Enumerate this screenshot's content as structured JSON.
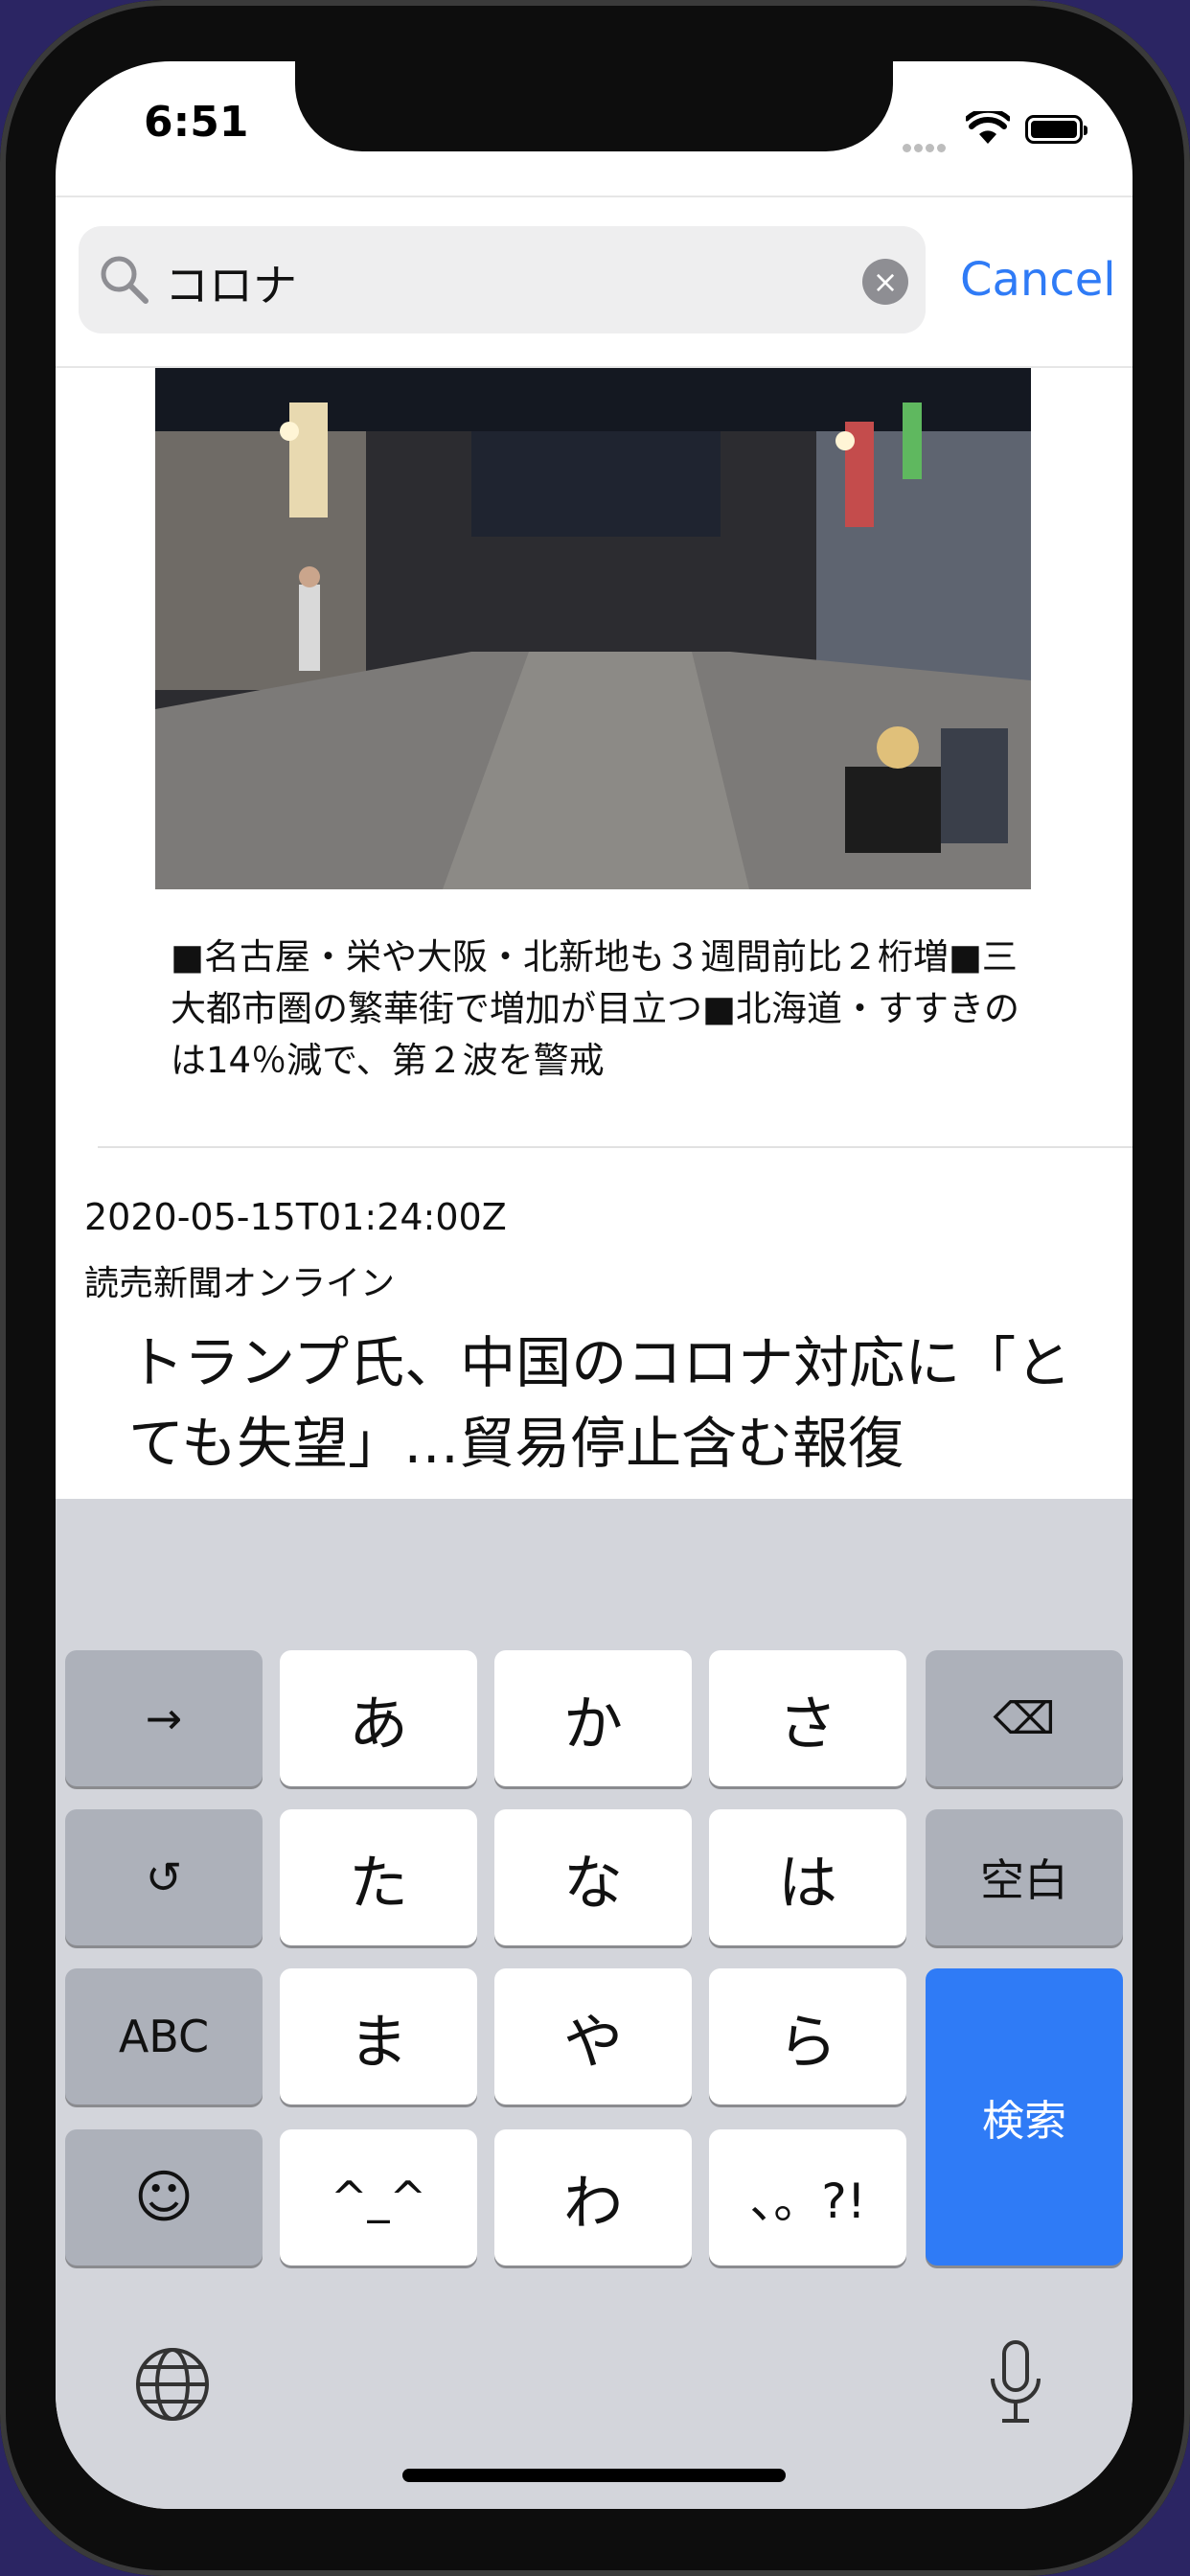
{
  "status_bar": {
    "time": "6:51"
  },
  "search": {
    "query": "コロナ",
    "clear_label": "×",
    "cancel_label": "Cancel"
  },
  "article1": {
    "caption": "■名古屋・栄や大阪・北新地も３週間前比２桁増■三大都市圏の繁華街で増加が目立つ■北海道・すすきのは14％減で、第２波を警戒"
  },
  "article2": {
    "timestamp": "2020-05-15T01:24:00Z",
    "source": "読売新聞オンライン",
    "headline": "トランプ氏、中国のコロナ対応に「とても失望」…貿易停止含む報復"
  },
  "keyboard": {
    "row1": [
      "→",
      "あ",
      "か",
      "さ",
      "⌫"
    ],
    "row2": [
      "↺",
      "た",
      "な",
      "は",
      "空白"
    ],
    "row3": [
      "ABC",
      "ま",
      "や",
      "ら"
    ],
    "row4": [
      "☺",
      "^_^",
      "わ",
      "、。?!"
    ],
    "search_key": "検索"
  },
  "colors": {
    "accent": "#2f7bf6",
    "keyboard_bg": "#d3d5db",
    "key_dark": "#adb1ba"
  }
}
